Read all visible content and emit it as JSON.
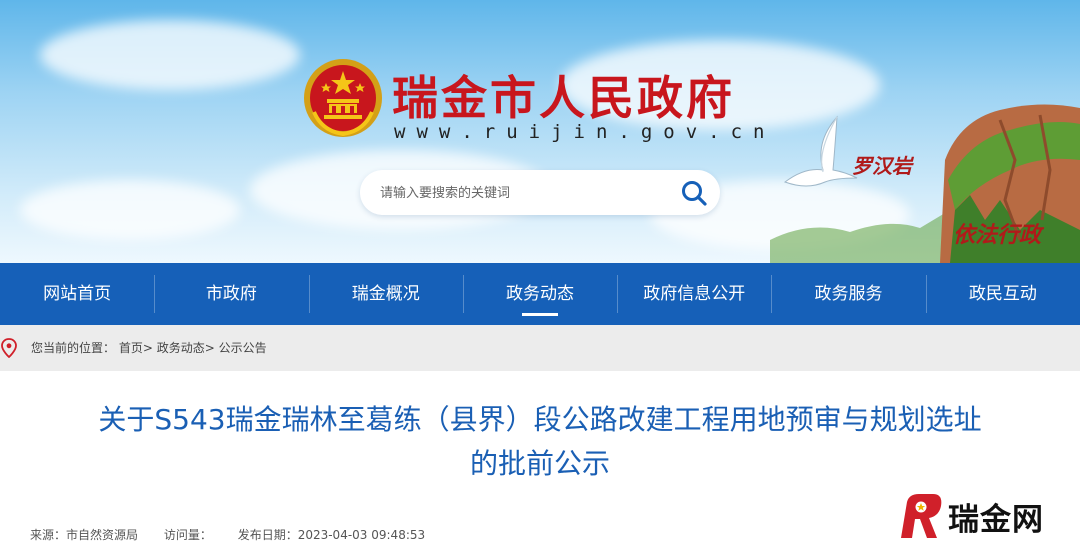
{
  "header": {
    "site_title": "瑞金市人民政府",
    "site_url": "www.ruijin.gov.cn",
    "search_placeholder": "请输入要搜索的关键词",
    "scenery_label_top": "罗汉岩",
    "scenery_label_bottom": "依法行政"
  },
  "nav": {
    "items": [
      "网站首页",
      "市政府",
      "瑞金概况",
      "政务动态",
      "政府信息公开",
      "政务服务",
      "政民互动"
    ],
    "active_index": 3
  },
  "breadcrumb": {
    "prefix": "您当前的位置：",
    "items": [
      "首页",
      "政务动态",
      "公示公告"
    ],
    "separator": ">"
  },
  "article": {
    "title_line1": "关于S543瑞金瑞林至葛练（县界）段公路改建工程用地预审与规划选址",
    "title_line2": "的批前公示",
    "source": "来源：市自然资源局",
    "views": "访问量：",
    "date": "发布日期：2023-04-03 09:48:53"
  },
  "watermark": {
    "text": "瑞金网"
  },
  "colors": {
    "nav_bg": "#1660b8",
    "title_blue": "#1a5fb4",
    "brand_red": "#c8161d"
  },
  "icons": [
    "national-emblem-icon",
    "search-icon",
    "location-pin-icon",
    "ruijin-net-logo-icon"
  ]
}
